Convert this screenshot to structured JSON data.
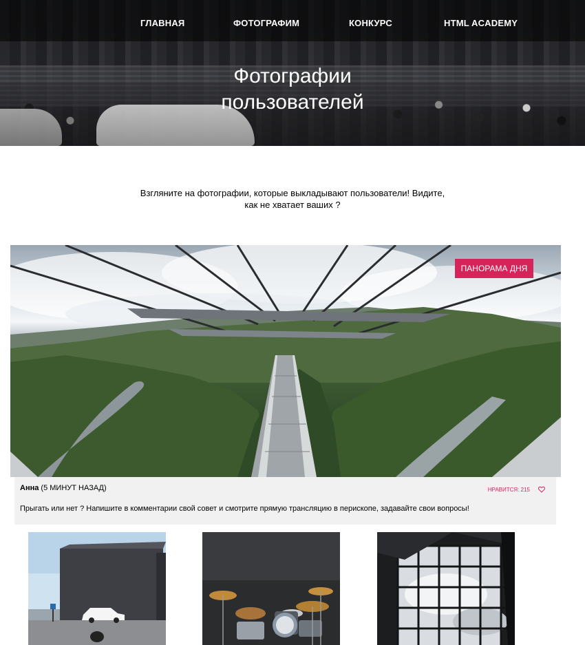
{
  "nav": {
    "items": [
      {
        "label": "Главная"
      },
      {
        "label": "Фотографим"
      },
      {
        "label": "Конкурс"
      },
      {
        "label": "HTML Academy"
      }
    ]
  },
  "hero": {
    "title_line1": "Фотографии",
    "title_line2": "пользователей"
  },
  "intro": {
    "line1": "Взгляните на фотографии, которые выкладывают пользователи! Видите,",
    "line2": "как не хватает ваших ?"
  },
  "featured": {
    "badge": "Панорама дня",
    "author_name": "Анна",
    "author_time": "(5 МИНУТ НАЗАД)",
    "likes_label": "Нравится: 215",
    "comment": "Прыгать или нет ? Напишите в комментарии свой совет и смотрите прямую трансляцию в перископе, задавайте свои вопросы!"
  },
  "colors": {
    "accent": "#d4245a",
    "caption_bg": "#f1f1f1"
  }
}
